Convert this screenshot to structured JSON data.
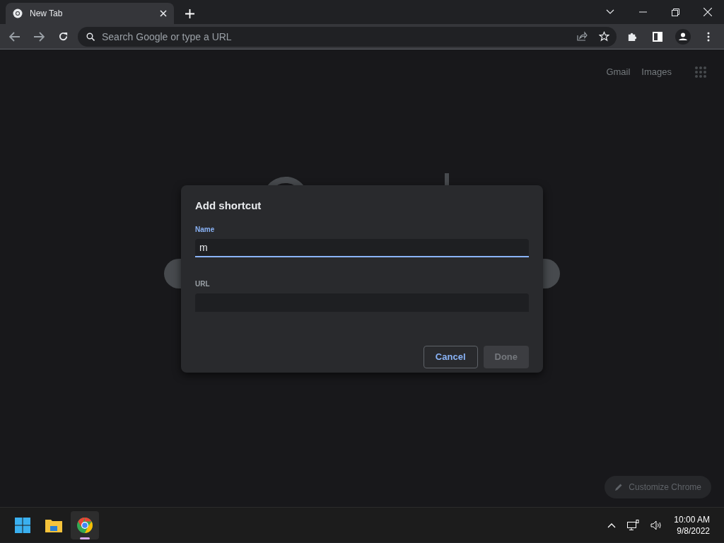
{
  "tab": {
    "title": "New Tab"
  },
  "omnibox": {
    "placeholder": "Search Google or type a URL"
  },
  "header_links": [
    "Gmail",
    "Images"
  ],
  "dialog": {
    "title": "Add shortcut",
    "fields": [
      {
        "label": "Name",
        "value": "m",
        "focused": true
      },
      {
        "label": "URL",
        "focused": false
      }
    ],
    "buttons": [
      {
        "label": "Cancel",
        "kind": "outline",
        "disabled": false
      },
      {
        "label": "Done",
        "kind": "primary",
        "disabled": true
      }
    ]
  },
  "customize": {
    "label": "Customize Chrome"
  },
  "taskbar": {
    "apps": [
      {
        "kind": "start",
        "active": false
      },
      {
        "kind": "explorer",
        "active": false
      },
      {
        "kind": "chrome",
        "active": true
      }
    ],
    "time": "10:00 AM",
    "date": "9/8/2022"
  }
}
